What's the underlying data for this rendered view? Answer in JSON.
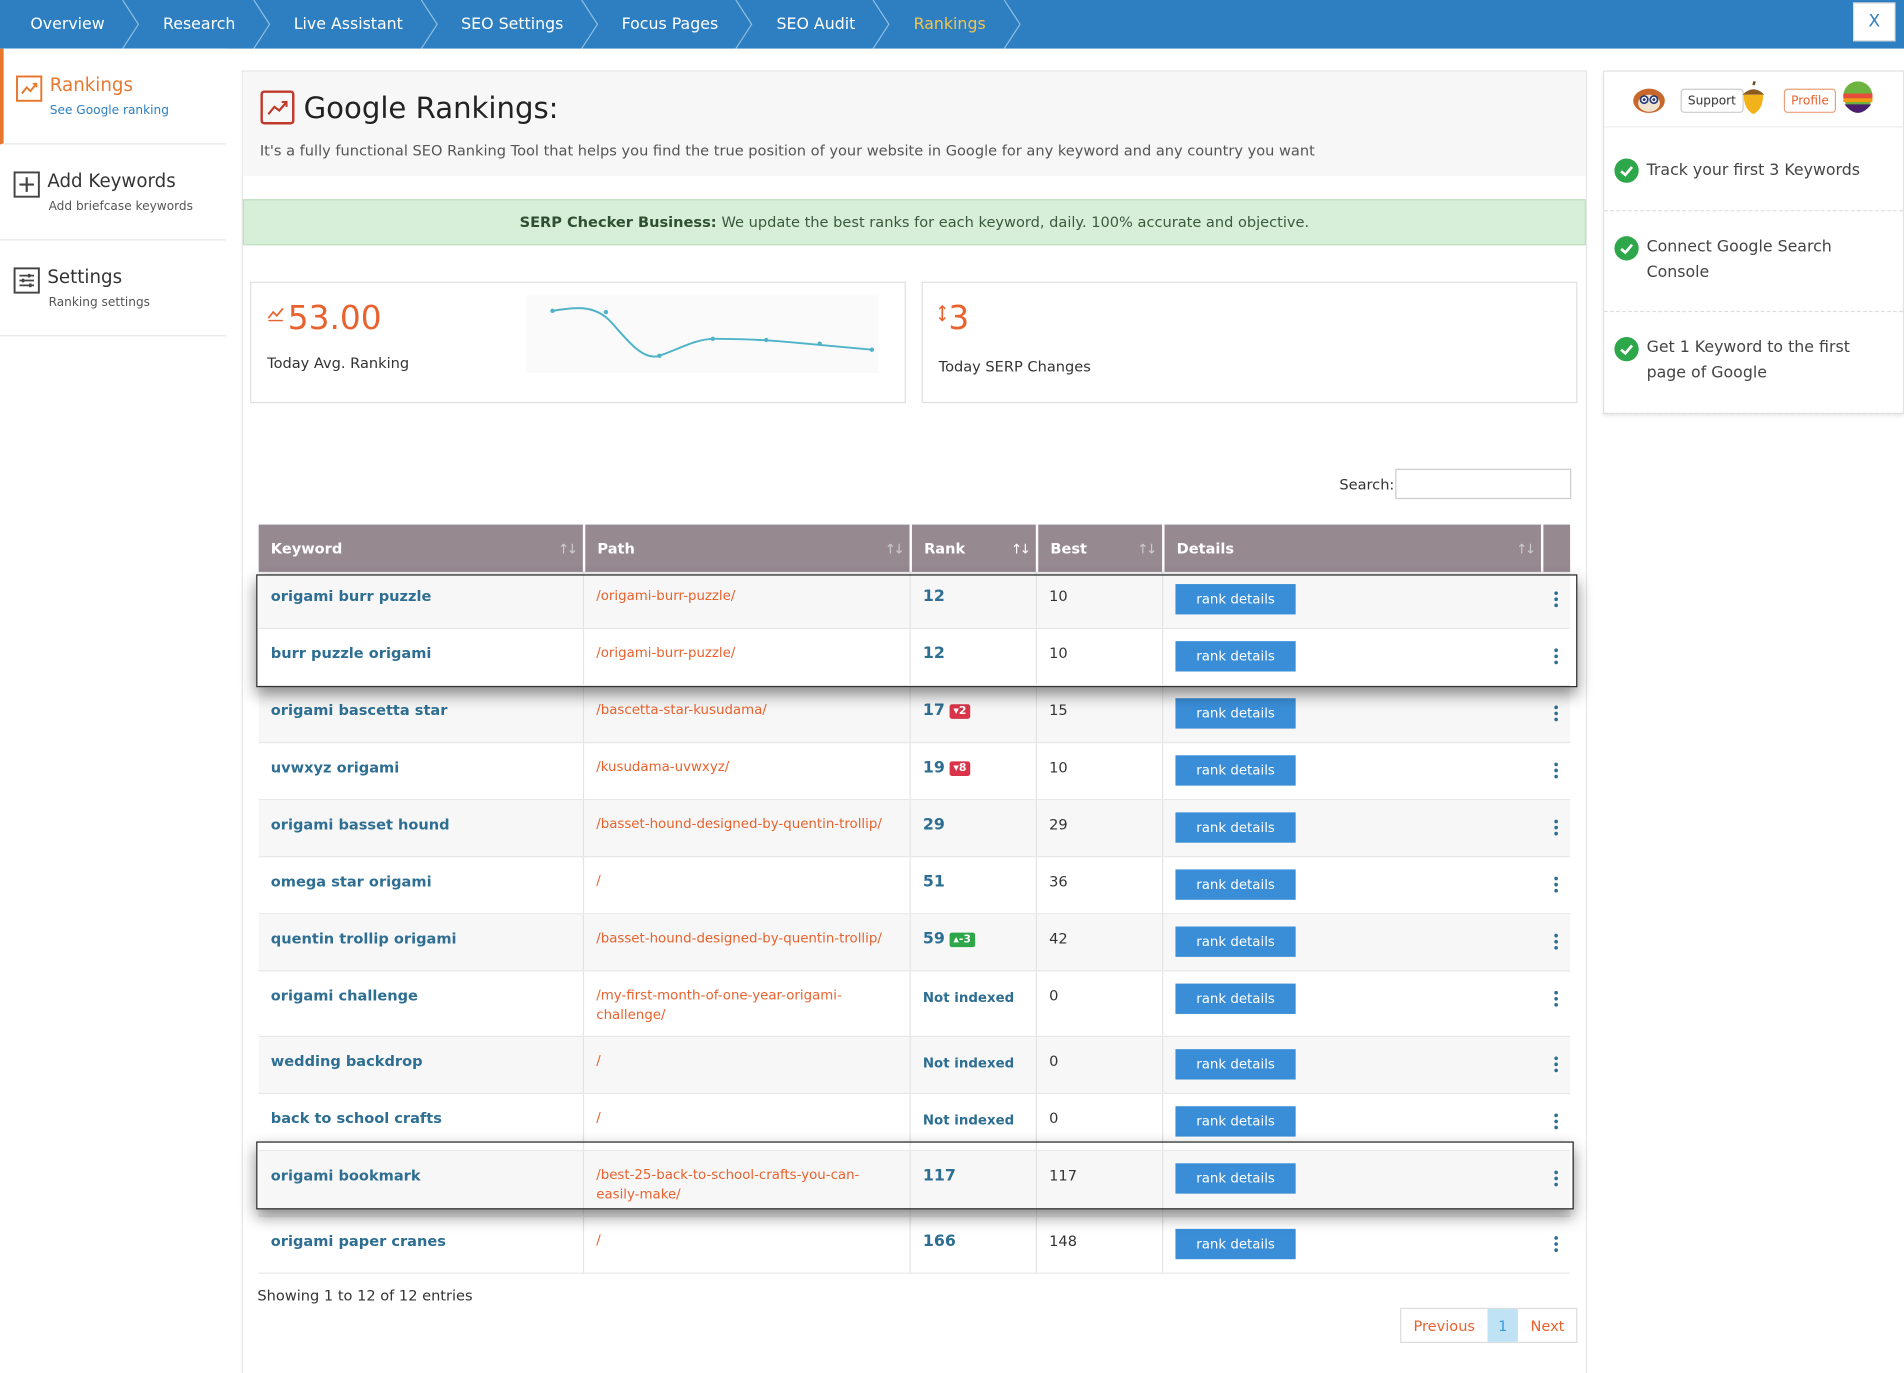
{
  "nav": {
    "items": [
      "Overview",
      "Research",
      "Live Assistant",
      "SEO Settings",
      "Focus Pages",
      "SEO Audit",
      "Rankings"
    ],
    "active": "Rankings",
    "close_label": "X"
  },
  "sidebar": {
    "items": [
      {
        "title": "Rankings",
        "subtitle": "See Google ranking",
        "icon": "chart-icon"
      },
      {
        "title": "Add Keywords",
        "subtitle": "Add briefcase keywords",
        "icon": "plus-square-icon"
      },
      {
        "title": "Settings",
        "subtitle": "Ranking settings",
        "icon": "sliders-icon"
      }
    ]
  },
  "header": {
    "title": "Google Rankings:",
    "description": "It's a fully functional SEO Ranking Tool that helps you find the true position of your website in Google for any keyword and any country you want"
  },
  "notice": {
    "bold": "SERP Checker Business:",
    "text": "We update the best ranks for each keyword, daily. 100% accurate and objective."
  },
  "stats": {
    "avg_value": "53.00",
    "avg_label": "Today Avg. Ranking",
    "serp_value": "3",
    "serp_label": "Today SERP Changes"
  },
  "search": {
    "label": "Search:",
    "value": ""
  },
  "table": {
    "columns": [
      "Keyword",
      "Path",
      "Rank",
      "Best",
      "Details"
    ],
    "rows": [
      {
        "keyword": "origami burr puzzle",
        "path": "/origami-burr-puzzle/",
        "rank": "12",
        "change": "",
        "dir": "",
        "best": "10"
      },
      {
        "keyword": "burr puzzle origami",
        "path": "/origami-burr-puzzle/",
        "rank": "12",
        "change": "",
        "dir": "",
        "best": "10"
      },
      {
        "keyword": "origami bascetta star",
        "path": "/bascetta-star-kusudama/",
        "rank": "17",
        "change": "2",
        "dir": "down",
        "best": "15"
      },
      {
        "keyword": "uvwxyz origami",
        "path": "/kusudama-uvwxyz/",
        "rank": "19",
        "change": "8",
        "dir": "down",
        "best": "10"
      },
      {
        "keyword": "origami basset hound",
        "path": "/basset-hound-designed-by-quentin-trollip/",
        "rank": "29",
        "change": "",
        "dir": "",
        "best": "29"
      },
      {
        "keyword": "omega star origami",
        "path": "/",
        "rank": "51",
        "change": "",
        "dir": "",
        "best": "36"
      },
      {
        "keyword": "quentin trollip origami",
        "path": "/basset-hound-designed-by-quentin-trollip/",
        "rank": "59",
        "change": "-3",
        "dir": "up",
        "best": "42"
      },
      {
        "keyword": "origami challenge",
        "path": "/my-first-month-of-one-year-origami-challenge/",
        "rank": "Not indexed",
        "change": "",
        "dir": "",
        "best": "0"
      },
      {
        "keyword": "wedding backdrop",
        "path": "/",
        "rank": "Not indexed",
        "change": "",
        "dir": "",
        "best": "0"
      },
      {
        "keyword": "back to school crafts",
        "path": "/",
        "rank": "Not indexed",
        "change": "",
        "dir": "",
        "best": "0"
      },
      {
        "keyword": "origami bookmark",
        "path": "/best-25-back-to-school-crafts-you-can-easily-make/",
        "rank": "117",
        "change": "",
        "dir": "",
        "best": "117"
      },
      {
        "keyword": "origami paper cranes",
        "path": "/",
        "rank": "166",
        "change": "",
        "dir": "",
        "best": "148"
      }
    ],
    "button_label": "rank details"
  },
  "footer": {
    "showing": "Showing 1 to 12 of 12 entries",
    "prev": "Previous",
    "page": "1",
    "next": "Next"
  },
  "right_panel": {
    "support_label": "Support",
    "profile_label": "Profile",
    "tasks": [
      "Track your first 3 Keywords",
      "Connect Google Search Console",
      "Get 1 Keyword to the first page of Google"
    ]
  },
  "colors": {
    "nav_bg": "#2d7fc1",
    "accent": "#e8622e",
    "table_header": "#978990",
    "button": "#3a8ed8",
    "success": "#2ea64a"
  }
}
